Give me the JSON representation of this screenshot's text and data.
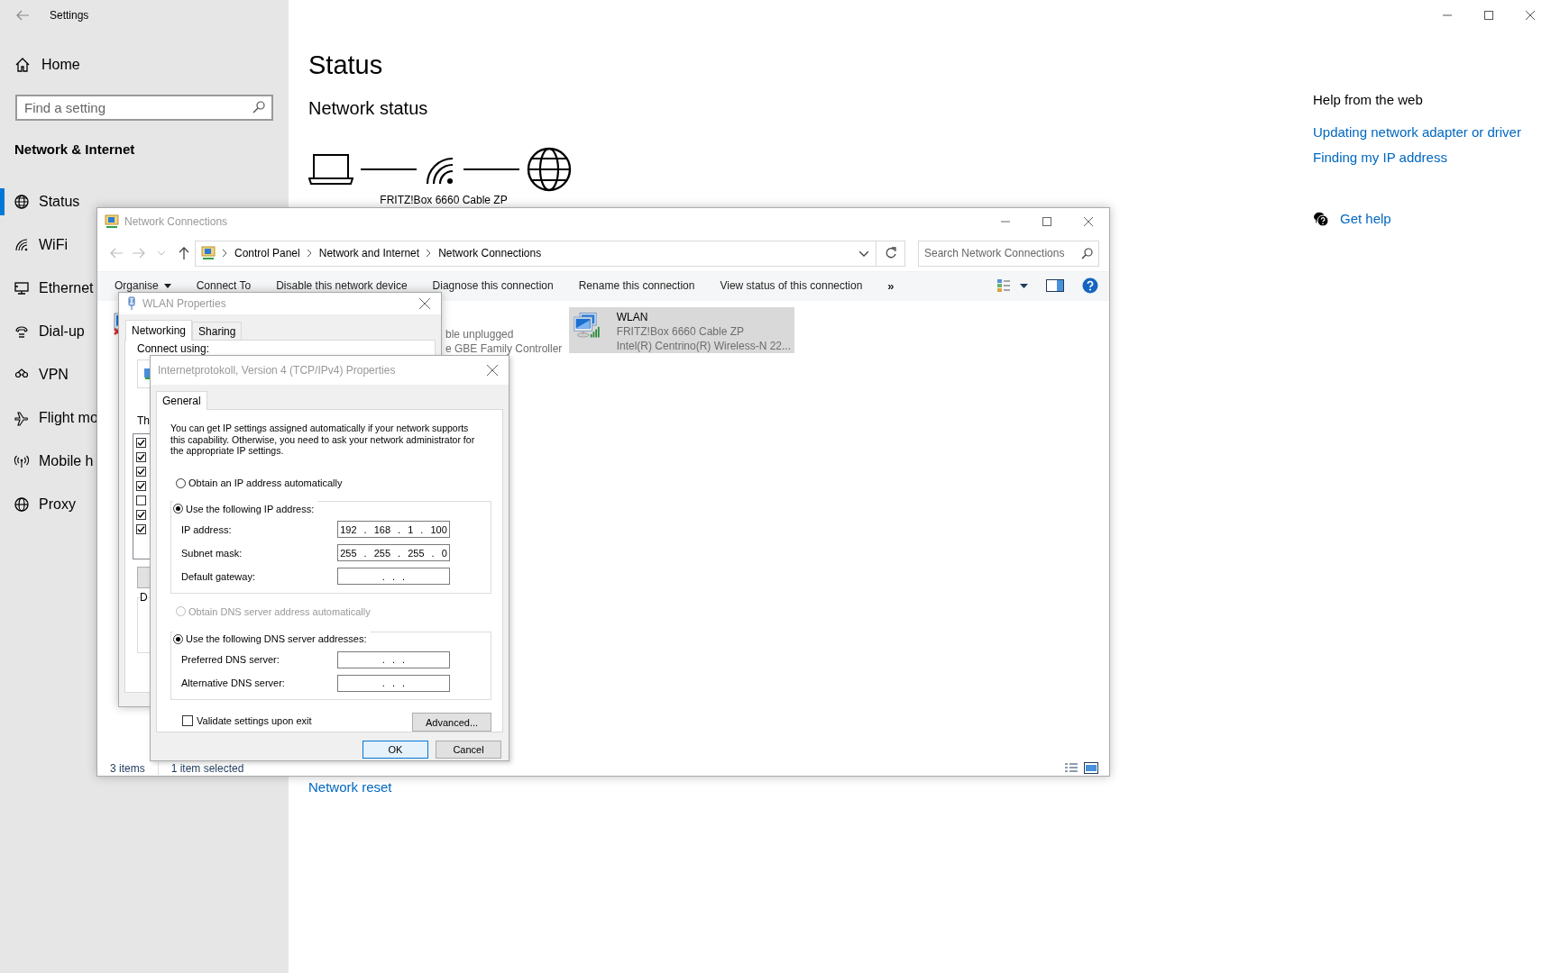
{
  "settings": {
    "title": "Settings",
    "home": "Home",
    "search": {
      "placeholder": "Find a setting"
    },
    "section": "Network & Internet",
    "nav": [
      {
        "label": "Status",
        "selected": true
      },
      {
        "label": "WiFi",
        "selected": false
      },
      {
        "label": "Ethernet",
        "selected": false
      },
      {
        "label": "Dial-up",
        "selected": false
      },
      {
        "label": "VPN",
        "selected": false
      },
      {
        "label": "Flight mo",
        "selected": false
      },
      {
        "label": "Mobile h",
        "selected": false
      },
      {
        "label": "Proxy",
        "selected": false
      }
    ],
    "page_title": "Status",
    "network_status": {
      "heading": "Network status",
      "router": "FRITZ!Box 6660 Cable ZP"
    },
    "network_reset": "Network reset",
    "help": {
      "heading": "Help from the web",
      "links": [
        "Updating network adapter or driver",
        "Finding my IP address"
      ],
      "get_help": "Get help"
    }
  },
  "network_connections": {
    "title": "Network Connections",
    "breadcrumb": [
      "Control Panel",
      "Network and Internet",
      "Network Connections"
    ],
    "search": {
      "placeholder": "Search Network Connections"
    },
    "toolbar": [
      {
        "label": "Organise",
        "kind": "menu"
      },
      {
        "label": "Connect To",
        "kind": "command"
      },
      {
        "label": "Disable this network device",
        "kind": "command"
      },
      {
        "label": "Diagnose this connection",
        "kind": "command"
      },
      {
        "label": "Rename this connection",
        "kind": "command"
      },
      {
        "label": "View status of this connection",
        "kind": "command"
      },
      {
        "label": "»",
        "kind": "more"
      }
    ],
    "items": [
      {
        "kind": "ethernet",
        "lines": [
          "ble unplugged",
          "e GBE Family Controller"
        ],
        "selected": false
      },
      {
        "kind": "wifi",
        "name": "WLAN",
        "lines": [
          "FRITZ!Box 6660 Cable ZP",
          "Intel(R) Centrino(R) Wireless-N 22..."
        ],
        "selected": true
      }
    ],
    "status_bar": [
      "3 items",
      "1 item selected"
    ]
  },
  "wlan_properties": {
    "title": "WLAN Properties",
    "tabs": [
      {
        "label": "Networking",
        "selected": true
      },
      {
        "label": "Sharing",
        "selected": false
      }
    ],
    "connect_label": "Connect using:",
    "items_label": "Th",
    "components": [
      {
        "checked": true
      },
      {
        "checked": true
      },
      {
        "checked": true
      },
      {
        "checked": true
      },
      {
        "checked": false
      },
      {
        "checked": true
      },
      {
        "checked": true
      }
    ],
    "description_label": "D"
  },
  "ipv4_properties": {
    "title": "Internetprotokoll, Version 4 (TCP/IPv4) Properties",
    "tabs": [
      {
        "label": "General",
        "selected": true
      }
    ],
    "intro": "You can get IP settings assigned automatically if your network supports this capability. Otherwise, you need to ask your network administrator for the appropriate IP settings.",
    "ip_mode": [
      {
        "label": "Obtain an IP address automatically",
        "selected": false,
        "disabled": false
      },
      {
        "label": "Use the following IP address:",
        "selected": true,
        "disabled": false
      }
    ],
    "ip_fields": [
      {
        "label": "IP address:",
        "value": "192 . 168 . 1 . 100"
      },
      {
        "label": "Subnet mask:",
        "value": "255 . 255 . 255 . 0"
      },
      {
        "label": "Default gateway:",
        "value": ". . ."
      }
    ],
    "dns_mode": [
      {
        "label": "Obtain DNS server address automatically",
        "selected": false,
        "disabled": true
      },
      {
        "label": "Use the following DNS server addresses:",
        "selected": true,
        "disabled": false
      }
    ],
    "dns_fields": [
      {
        "label": "Preferred DNS server:",
        "value": ". . ."
      },
      {
        "label": "Alternative DNS server:",
        "value": ". . ."
      }
    ],
    "validate": {
      "label": "Validate settings upon exit",
      "checked": false
    },
    "advanced": "Advanced...",
    "buttons": [
      {
        "label": "OK",
        "kind": "default"
      },
      {
        "label": "Cancel",
        "kind": "normal"
      }
    ]
  }
}
